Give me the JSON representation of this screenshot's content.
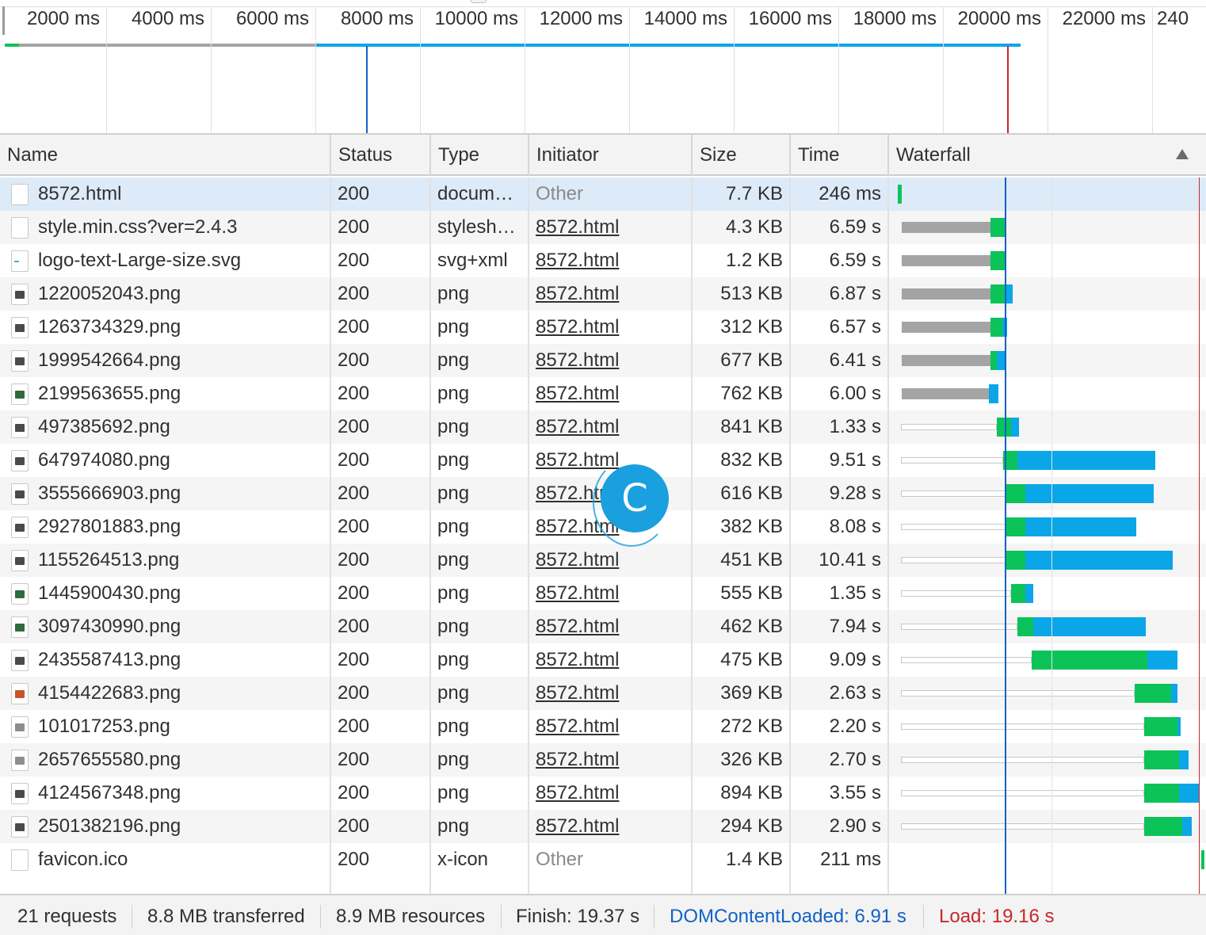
{
  "overview": {
    "ticks": [
      "2000 ms",
      "4000 ms",
      "6000 ms",
      "8000 ms",
      "10000 ms",
      "12000 ms",
      "14000 ms",
      "16000 ms",
      "18000 ms",
      "20000 ms",
      "22000 ms",
      "240"
    ],
    "colors": {
      "queue": "#a4a4a4",
      "content": "#0aa6e8",
      "ttfb": "#0cc35a",
      "dom_content_loaded": "#1162c6",
      "load": "#c62828"
    }
  },
  "columns": {
    "name": "Name",
    "status": "Status",
    "type": "Type",
    "initiator": "Initiator",
    "size": "Size",
    "time": "Time",
    "waterfall": "Waterfall"
  },
  "rows": [
    {
      "name": "8572.html",
      "status": "200",
      "type": "docum…",
      "initiator": "Other",
      "size": "7.7 KB",
      "time": "246 ms",
      "icon": "document-icon"
    },
    {
      "name": "style.min.css?ver=2.4.3",
      "status": "200",
      "type": "stylesh…",
      "initiator": "8572.html",
      "size": "4.3 KB",
      "time": "6.59 s",
      "icon": "stylesheet-icon"
    },
    {
      "name": "logo-text-Large-size.svg",
      "status": "200",
      "type": "svg+xml",
      "initiator": "8572.html",
      "size": "1.2 KB",
      "time": "6.59 s",
      "icon": "svg-icon"
    },
    {
      "name": "1220052043.png",
      "status": "200",
      "type": "png",
      "initiator": "8572.html",
      "size": "513 KB",
      "time": "6.87 s",
      "icon": "image-icon"
    },
    {
      "name": "1263734329.png",
      "status": "200",
      "type": "png",
      "initiator": "8572.html",
      "size": "312 KB",
      "time": "6.57 s",
      "icon": "image-icon"
    },
    {
      "name": "1999542664.png",
      "status": "200",
      "type": "png",
      "initiator": "8572.html",
      "size": "677 KB",
      "time": "6.41 s",
      "icon": "image-icon"
    },
    {
      "name": "2199563655.png",
      "status": "200",
      "type": "png",
      "initiator": "8572.html",
      "size": "762 KB",
      "time": "6.00 s",
      "icon": "image-icon"
    },
    {
      "name": "497385692.png",
      "status": "200",
      "type": "png",
      "initiator": "8572.html",
      "size": "841 KB",
      "time": "1.33 s",
      "icon": "image-icon"
    },
    {
      "name": "647974080.png",
      "status": "200",
      "type": "png",
      "initiator": "8572.html",
      "size": "832 KB",
      "time": "9.51 s",
      "icon": "image-icon"
    },
    {
      "name": "3555666903.png",
      "status": "200",
      "type": "png",
      "initiator": "8572.html",
      "size": "616 KB",
      "time": "9.28 s",
      "icon": "image-icon"
    },
    {
      "name": "2927801883.png",
      "status": "200",
      "type": "png",
      "initiator": "8572.html",
      "size": "382 KB",
      "time": "8.08 s",
      "icon": "image-icon"
    },
    {
      "name": "1155264513.png",
      "status": "200",
      "type": "png",
      "initiator": "8572.html",
      "size": "451 KB",
      "time": "10.41 s",
      "icon": "image-icon"
    },
    {
      "name": "1445900430.png",
      "status": "200",
      "type": "png",
      "initiator": "8572.html",
      "size": "555 KB",
      "time": "1.35 s",
      "icon": "image-icon"
    },
    {
      "name": "3097430990.png",
      "status": "200",
      "type": "png",
      "initiator": "8572.html",
      "size": "462 KB",
      "time": "7.94 s",
      "icon": "image-icon"
    },
    {
      "name": "2435587413.png",
      "status": "200",
      "type": "png",
      "initiator": "8572.html",
      "size": "475 KB",
      "time": "9.09 s",
      "icon": "image-icon"
    },
    {
      "name": "4154422683.png",
      "status": "200",
      "type": "png",
      "initiator": "8572.html",
      "size": "369 KB",
      "time": "2.63 s",
      "icon": "image-icon"
    },
    {
      "name": "101017253.png",
      "status": "200",
      "type": "png",
      "initiator": "8572.html",
      "size": "272 KB",
      "time": "2.20 s",
      "icon": "image-icon"
    },
    {
      "name": "2657655580.png",
      "status": "200",
      "type": "png",
      "initiator": "8572.html",
      "size": "326 KB",
      "time": "2.70 s",
      "icon": "image-icon"
    },
    {
      "name": "4124567348.png",
      "status": "200",
      "type": "png",
      "initiator": "8572.html",
      "size": "894 KB",
      "time": "3.55 s",
      "icon": "image-icon"
    },
    {
      "name": "2501382196.png",
      "status": "200",
      "type": "png",
      "initiator": "8572.html",
      "size": "294 KB",
      "time": "2.90 s",
      "icon": "image-icon"
    },
    {
      "name": "favicon.ico",
      "status": "200",
      "type": "x-icon",
      "initiator": "Other",
      "size": "1.4 KB",
      "time": "211 ms",
      "icon": "document-icon"
    }
  ],
  "status_bar": {
    "requests": "21 requests",
    "transferred": "8.8 MB transferred",
    "resources": "8.9 MB resources",
    "finish": "Finish: 19.37 s",
    "dom_content_loaded": "DOMContentLoaded: 6.91 s",
    "load": "Load: 19.16 s"
  },
  "overlay": {
    "letter": "C"
  }
}
